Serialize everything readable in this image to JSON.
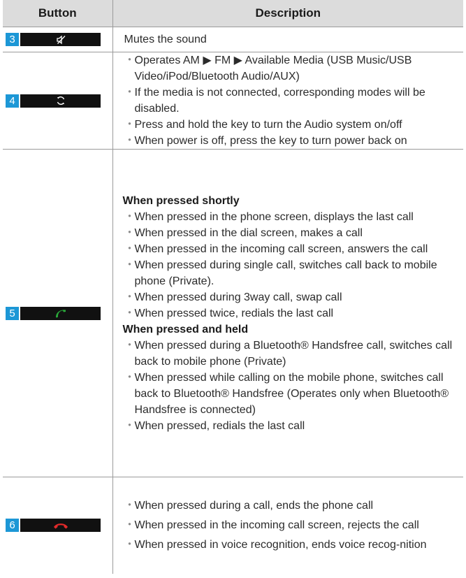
{
  "table": {
    "header": {
      "button": "Button",
      "description": "Description"
    },
    "rows": [
      {
        "number": "3",
        "key_icon": "mute-icon",
        "plain": "Mutes the sound"
      },
      {
        "number": "4",
        "key_icon": "mode-cycle-icon",
        "items": [
          "Operates AM ▶ FM ▶ Available Media  (USB Music/USB Video/iPod/Bluetooth Audio/AUX)",
          "If the media is not connected, corresponding modes will be disabled.",
          "Press and hold the key to turn the Audio system on/off",
          "When power is off, press the key to turn power back on"
        ]
      },
      {
        "number": "5",
        "key_icon": "call-icon",
        "key_icon_color": "#2aaa3a",
        "sections": [
          {
            "title": "When pressed shortly",
            "items": [
              "When pressed in the phone screen, displays the last call",
              "When pressed in the dial screen, makes a call",
              "When pressed in the incoming call screen, answers the call",
              "When pressed during single call, switches call back to mobile phone (Private).",
              "When pressed during 3way call, swap call",
              "When pressed twice, redials the last call"
            ]
          },
          {
            "title": "When pressed and held",
            "items": [
              "When pressed during a Bluetooth® Handsfree call, switches call back to mobile phone (Private)",
              "When pressed while calling on the mobile phone, switches call back to Bluetooth® Handsfree (Operates only when Bluetooth® Handsfree is connected)",
              "When pressed, redials the last call"
            ]
          }
        ]
      },
      {
        "number": "6",
        "key_icon": "end-call-icon",
        "key_icon_color": "#e32a2a",
        "items": [
          "When pressed during a call, ends the phone call",
          "When pressed in the incoming call screen, rejects the call",
          "When pressed in voice recognition, ends voice recog-nition"
        ]
      }
    ],
    "bullet": "・"
  },
  "colors": {
    "number_badge": "#1c97d6",
    "key_bg": "#111111",
    "header_bg": "#dcdcdc",
    "rule": "#9a9a9a"
  }
}
